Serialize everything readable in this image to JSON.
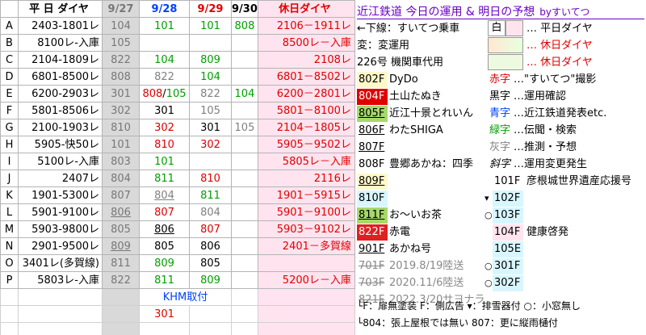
{
  "header": {
    "label": "平 日 ダイヤ",
    "d0": "9/27",
    "d1": "9/28",
    "d2": "9/29",
    "d3": "9/30",
    "hol": "休日ダイヤ"
  },
  "rows": [
    {
      "id": "A",
      "train": "2403-1801レ",
      "v": [
        "104",
        "101",
        "101",
        "808"
      ],
      "hol": "2106－1911レ"
    },
    {
      "id": "B",
      "train": "8100レ-入庫",
      "v": [
        "105",
        "",
        "",
        ""
      ],
      "hol": "8500レ－入庫"
    },
    {
      "id": "C",
      "train": "2104-1809レ",
      "v": [
        "822",
        "104",
        "809",
        ""
      ],
      "hol": "2108レ"
    },
    {
      "id": "D",
      "train": "6801-8500レ",
      "v": [
        "808",
        "822",
        "104",
        ""
      ],
      "hol": "6801－8502レ"
    },
    {
      "id": "E",
      "train": "6200-2903レ",
      "v": [
        "301",
        "808/105",
        "822",
        "104"
      ],
      "hol": "6200－2801レ"
    },
    {
      "id": "F",
      "train": "5801-8506レ",
      "v": [
        "302",
        "301",
        "105",
        ""
      ],
      "hol": "5801－8100レ"
    },
    {
      "id": "G",
      "train": "2100-1903レ",
      "v": [
        "810",
        "302",
        "301",
        "105"
      ],
      "hol": "2104－1805レ"
    },
    {
      "id": "H",
      "train": "5905-快50レ",
      "v": [
        "101",
        "810",
        "302",
        ""
      ],
      "hol": "5905－9502レ"
    },
    {
      "id": "I",
      "train": "5100レ-入庫",
      "v": [
        "803",
        "101",
        "",
        ""
      ],
      "hol": "5805レ－入庫"
    },
    {
      "id": "J",
      "train": "2407レ",
      "v": [
        "804",
        "811",
        "810",
        ""
      ],
      "hol": "2116レ"
    },
    {
      "id": "K",
      "train": "1901-5300レ",
      "v": [
        "807",
        "804",
        "811",
        ""
      ],
      "hol": "1901－5915レ"
    },
    {
      "id": "L",
      "train": "5901-9100レ",
      "v": [
        "806",
        "807",
        "804",
        ""
      ],
      "hol": "5901－9100レ"
    },
    {
      "id": "M",
      "train": "5903-9800レ",
      "v": [
        "805",
        "806",
        "807",
        ""
      ],
      "hol": "5903－9102レ"
    },
    {
      "id": "N",
      "train": "2901-9500レ",
      "v": [
        "809",
        "805",
        "806",
        ""
      ],
      "hol": "2401－多賀線"
    },
    {
      "id": "O",
      "train": "3401レ(多賀線)",
      "v": [
        "811",
        "809",
        "805",
        ""
      ],
      "hol": ""
    },
    {
      "id": "P",
      "train": "5803レ-入庫",
      "v": [
        "822",
        "811",
        "809",
        ""
      ],
      "hol": "5200レ－入庫"
    }
  ],
  "extra": {
    "khm": "KHM取付",
    "khm_val": "301"
  },
  "right": {
    "title": "近江鉄道 今日の運用 & 明日の予想",
    "by": "byすいてつ",
    "l1": "←下線：すいてつ乗車",
    "l2": "変：変運用",
    "l3": "226号 機関車代用",
    "box_white": "白",
    "leg1": "… 平日ダイヤ",
    "leg2": "… 休日ダイヤ",
    "leg3": "… 休日ダイヤ",
    "trains": [
      {
        "code": "802F",
        "name": "DyDo"
      },
      {
        "code": "804F",
        "name": "土山たぬき"
      },
      {
        "code": "805F",
        "name": "近江十景とれいん"
      },
      {
        "code": "806F",
        "name": "わたSHIGA"
      },
      {
        "code": "807F",
        "name": ""
      },
      {
        "code": "808F",
        "name": "豊郷あかね：四季"
      },
      {
        "code": "809F",
        "name": ""
      },
      {
        "code": "810F",
        "name": ""
      },
      {
        "code": "811F",
        "name": "お～いお茶"
      },
      {
        "code": "822F",
        "name": "赤電"
      },
      {
        "code": "901F",
        "name": "あかね号"
      },
      {
        "code": "701F",
        "name": "2019.8/19陸送"
      },
      {
        "code": "703F",
        "name": "2020.11/6陸送"
      },
      {
        "code": "821F",
        "name": "2022.3/20サヨナラ"
      }
    ],
    "colors": [
      {
        "k": "赤字",
        "v": "…\"すいてつ\"撮影"
      },
      {
        "k": "黒字",
        "v": "…運用確認"
      },
      {
        "k": "青字",
        "v": "…近江鉄道発表etc."
      },
      {
        "k": "緑字",
        "v": "…伝聞・検索"
      },
      {
        "k": "灰字",
        "v": "…推測・予想"
      },
      {
        "k": "斜字",
        "v": "…運用変更発生"
      }
    ],
    "small": [
      {
        "code": "101F",
        "name": "彦根城世界遺産応援号",
        "mark": ""
      },
      {
        "code": "102F",
        "name": "",
        "mark": "▾"
      },
      {
        "code": "103F",
        "name": "",
        "mark": "○"
      },
      {
        "code": "104F",
        "name": "健康啓発",
        "mark": ""
      },
      {
        "code": "105E",
        "name": "",
        "mark": ""
      },
      {
        "code": "301F",
        "name": "",
        "mark": "○"
      },
      {
        "code": "302F",
        "name": "",
        "mark": "○"
      }
    ],
    "note1": "└F：扉無塗装 F：側広告 ▾：排雪器付 ○：小窓無し",
    "note2": "└804：張上屋根では無い 807：更に縦雨樋付"
  }
}
